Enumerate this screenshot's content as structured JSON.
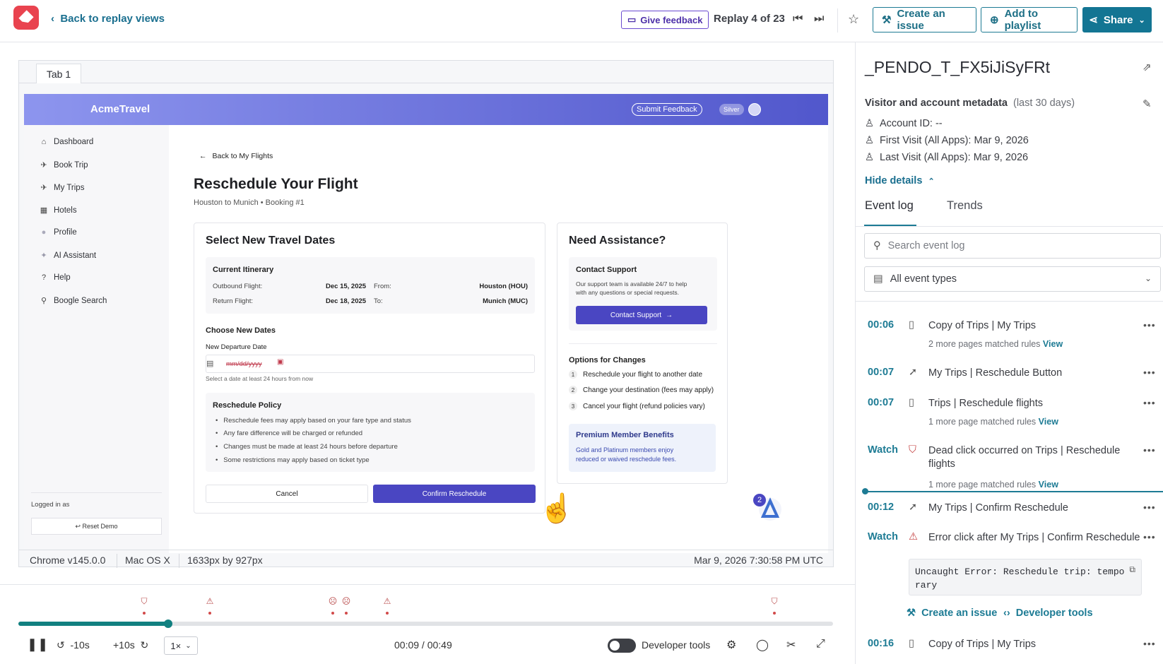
{
  "topbar": {
    "back_label": "Back to replay views",
    "give_feedback": "Give feedback",
    "replay_count": "Replay 4 of 23",
    "create_issue": "Create an issue",
    "add_playlist": "Add to playlist",
    "share": "Share"
  },
  "replay": {
    "tab_label": "Tab 1",
    "app": {
      "brand": "AcmeTravel",
      "submit_feedback": "Submit Feedback",
      "tier": "Silver",
      "sidebar": [
        "Dashboard",
        "Book Trip",
        "My Trips",
        "Hotels",
        "Profile",
        "AI Assistant",
        "Help",
        "Boogle Search"
      ],
      "logged_in": "Logged in as",
      "reset_demo": "↩ Reset Demo",
      "back_link": "Back to My Flights",
      "title": "Reschedule Your Flight",
      "subtitle": "Houston to Munich • Booking #1",
      "dates_card": {
        "title": "Select New Travel Dates",
        "itinerary_title": "Current Itinerary",
        "outbound_label": "Outbound Flight:",
        "outbound_date": "Dec 15, 2025",
        "from_label": "From:",
        "from_value": "Houston (HOU)",
        "return_label": "Return Flight:",
        "return_date": "Dec 18, 2025",
        "to_label": "To:",
        "to_value": "Munich (MUC)",
        "choose_title": "Choose New Dates",
        "departure_label": "New Departure Date",
        "date_placeholder": "mm/dd/yyyy",
        "hint": "Select a date at least 24 hours from now",
        "policy_title": "Reschedule Policy",
        "policy": [
          "Reschedule fees may apply based on your fare type and status",
          "Any fare difference will be charged or refunded",
          "Changes must be made at least 24 hours before departure",
          "Some restrictions may apply based on ticket type"
        ],
        "cancel": "Cancel",
        "confirm": "Confirm Reschedule"
      },
      "assist_card": {
        "title": "Need Assistance?",
        "contact_title": "Contact Support",
        "contact_text_1": "Our support team is available 24/7 to help",
        "contact_text_2": "with any questions or special requests.",
        "contact_btn": "Contact Support",
        "options_title": "Options for Changes",
        "options": [
          {
            "n": "1",
            "t": "Reschedule your flight to another date"
          },
          {
            "n": "2",
            "t": "Change your destination (fees may apply)"
          },
          {
            "n": "3",
            "t": "Cancel your flight (refund policies vary)"
          }
        ],
        "premium_title": "Premium Member Benefits",
        "premium_text_1": "Gold and Platinum members enjoy",
        "premium_text_2": "reduced or waived reschedule fees."
      },
      "badge_count": "2"
    },
    "footer": {
      "browser": "Chrome v145.0.0",
      "os": "Mac OS X",
      "size": "1633px by 927px",
      "timestamp": "Mar 9, 2026 7:30:58 PM UTC"
    }
  },
  "player": {
    "back10": "-10s",
    "fwd10": "+10s",
    "speed": "1×",
    "time": "00:09 / 00:49",
    "progress_fraction": 0.184,
    "devtools": "Developer tools"
  },
  "panel": {
    "title": "_PENDO_T_FX5iJiSyFRt",
    "meta_heading": "Visitor and account metadata",
    "meta_range": "(last 30 days)",
    "account": "Account ID: --",
    "first_visit": "First Visit (All Apps): Mar 9, 2026",
    "last_visit": "Last Visit (All Apps): Mar 9, 2026",
    "hide_details": "Hide details",
    "tab_event_log": "Event log",
    "tab_trends": "Trends",
    "search_placeholder": "Search event log",
    "event_type": "All event types",
    "events": [
      {
        "time": "00:06",
        "text": "Copy of Trips | My Trips",
        "sub": "2 more pages matched rules",
        "view": "View"
      },
      {
        "time": "00:07",
        "text": "My Trips | Reschedule Button"
      },
      {
        "time": "00:07",
        "text": "Trips | Reschedule flights",
        "sub": "1 more page matched rules",
        "view": "View"
      },
      {
        "time": "Watch",
        "text": "Dead click occurred on Trips | Reschedule flights",
        "sub": "1 more page matched rules",
        "view": "View"
      },
      {
        "time": "00:12",
        "text": "My Trips | Confirm Reschedule"
      },
      {
        "time": "Watch",
        "text": "Error click after My Trips | Confirm Reschedule"
      },
      {
        "time": "00:16",
        "text": "Copy of Trips | My Trips"
      }
    ],
    "error_text": "Uncaught Error: Reschedule trip: tempo rary",
    "create_issue": "Create an issue",
    "dev_tools": "Developer tools"
  }
}
